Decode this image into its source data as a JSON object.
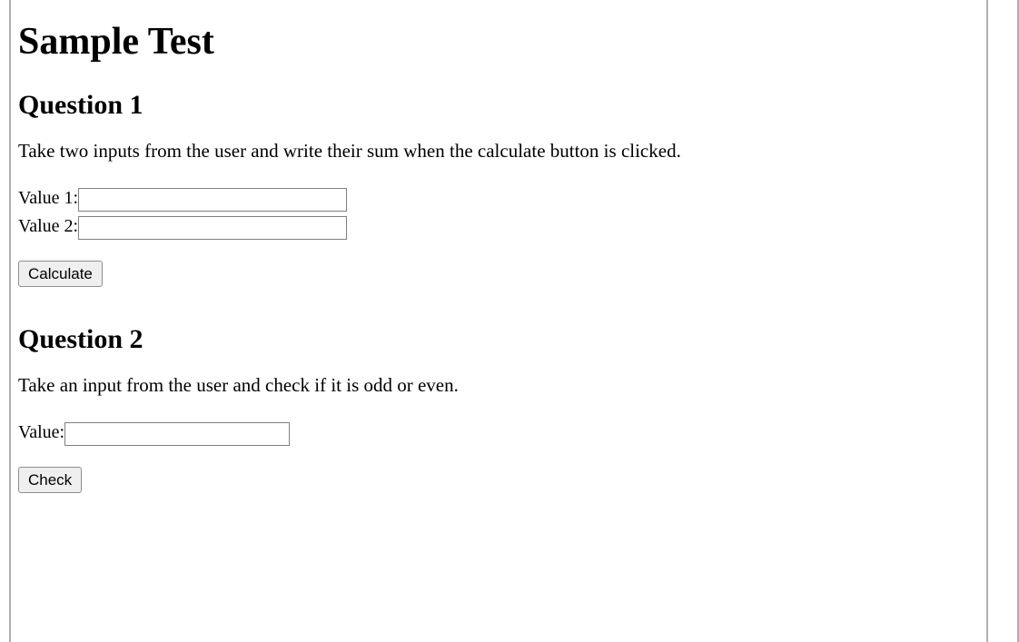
{
  "page": {
    "title": "Sample Test"
  },
  "q1": {
    "heading": "Question 1",
    "prompt": "Take two inputs from the user and write their sum when the calculate button is clicked.",
    "label1": "Value 1: ",
    "input1_value": "",
    "label2": "Value 2: ",
    "input2_value": "",
    "button_label": "Calculate"
  },
  "q2": {
    "heading": "Question 2",
    "prompt": "Take an input from the user and check if it is odd or even.",
    "label": "Value: ",
    "input_value": "",
    "button_label": "Check"
  }
}
